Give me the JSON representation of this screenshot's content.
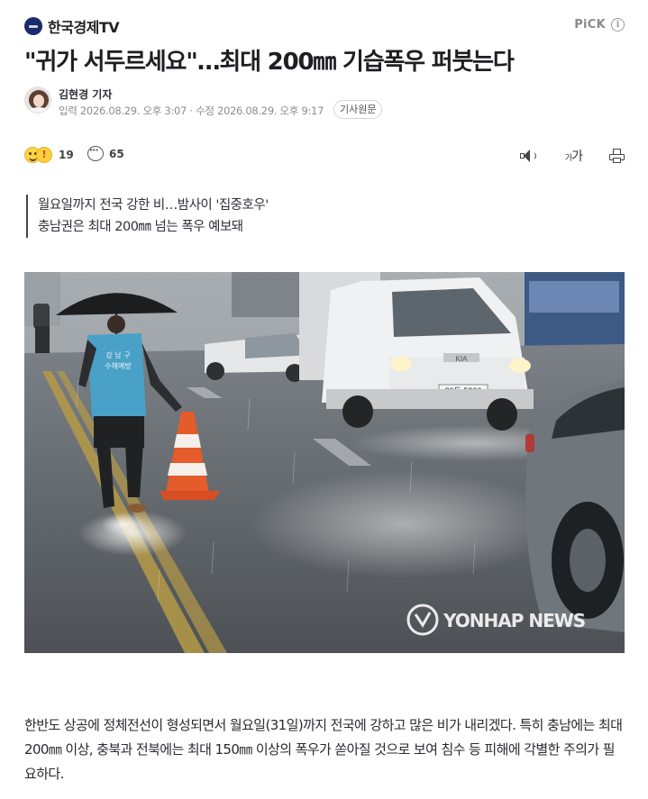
{
  "press": {
    "name": "한국경제TV",
    "pick_label": "PiCK",
    "info_icon": "i"
  },
  "headline": "\"귀가 서두르세요\"…최대 200㎜ 기습폭우 퍼붓는다",
  "byline": {
    "reporter": "김현경 기자",
    "dates": "입력 2026.08.29. 오후 3:07 · 수정 2026.08.29. 오후 9:17",
    "original_button": "기사원문"
  },
  "toolbar": {
    "reaction_count": "19",
    "comment_count": "65",
    "font_size_label": "가",
    "font_size_small": "가"
  },
  "summary": [
    "월요일까지 전국 강한 비…밤사이 '집중호우'",
    "충남권은 최대 200㎜ 넘는 폭우 예보돼"
  ],
  "photo": {
    "watermark": "YONHAP NEWS",
    "vest_text_1": "강 남 구",
    "vest_text_2": "수해예방",
    "plate": "80두 5366",
    "vehicle_brand": "KIA"
  },
  "article_body": "한반도 상공에 정체전선이 형성되면서 월요일(31일)까지 전국에 강하고 많은 비가 내리겠다. 특히 충남에는 최대 200㎜ 이상, 충북과 전북에는 최대 150㎜ 이상의 폭우가 쏟아질 것으로 보여 침수 등 피해에 각별한 주의가 필요하다.",
  "colors": {
    "press_logo": "#1b2a6b",
    "text": "#1e1e23",
    "muted": "#8d8d8d"
  }
}
